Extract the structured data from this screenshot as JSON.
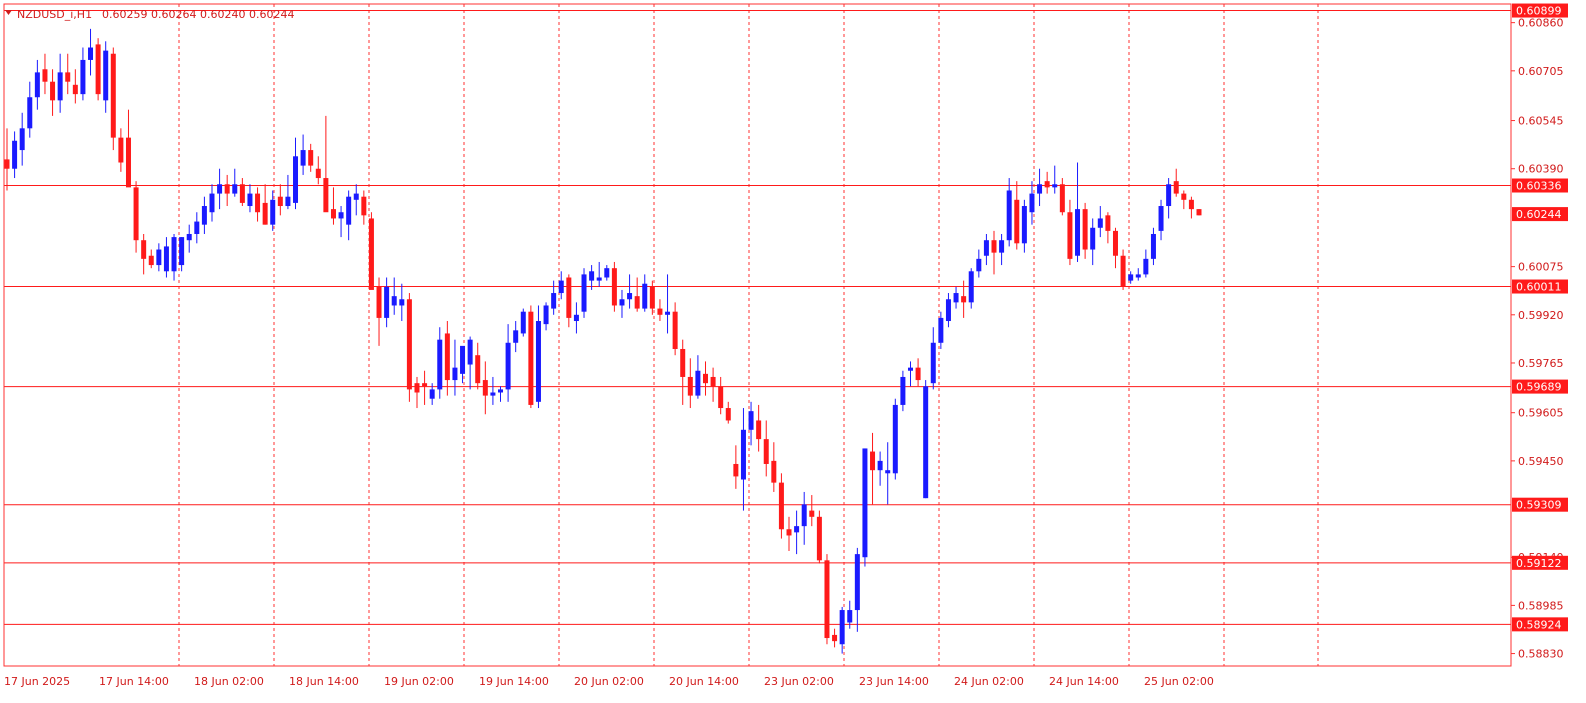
{
  "header": {
    "symbol": "NZDUSD_i,H1",
    "ohlc": "0.60259 0.60264 0.60240 0.60244"
  },
  "colors": {
    "bull": "#1a1aff",
    "bear": "#ff1a1a",
    "axis": "#ff3030",
    "grid": "#ff3030",
    "label_bg": "#ff1a1a"
  },
  "chart_data": {
    "type": "candlestick",
    "ylim": [
      0.5879,
      0.6092
    ],
    "price_axis_ticks": [
      "0.60860",
      "0.60705",
      "0.60545",
      "0.60390",
      "0.60075",
      "0.59920",
      "0.59765",
      "0.59605",
      "0.59450",
      "0.59140",
      "0.58985",
      "0.58830"
    ],
    "time_axis_labels": [
      "17 Jun 2025",
      "17 Jun 14:00",
      "18 Jun 02:00",
      "18 Jun 14:00",
      "19 Jun 02:00",
      "19 Jun 14:00",
      "20 Jun 02:00",
      "20 Jun 14:00",
      "23 Jun 02:00",
      "23 Jun 14:00",
      "24 Jun 02:00",
      "24 Jun 14:00",
      "25 Jun 02:00"
    ],
    "horizontal_levels": [
      "0.60899",
      "0.60336",
      "0.60011",
      "0.59689",
      "0.59309",
      "0.59122",
      "0.58924"
    ],
    "current_price": "0.60244",
    "candles": [
      {
        "o": 0.6042,
        "h": 0.6052,
        "l": 0.6032,
        "c": 0.6039
      },
      {
        "o": 0.6039,
        "h": 0.6051,
        "l": 0.6036,
        "c": 0.6048
      },
      {
        "o": 0.6045,
        "h": 0.6057,
        "l": 0.604,
        "c": 0.6052
      },
      {
        "o": 0.6052,
        "h": 0.6067,
        "l": 0.6049,
        "c": 0.6062
      },
      {
        "o": 0.6062,
        "h": 0.6074,
        "l": 0.6058,
        "c": 0.607
      },
      {
        "o": 0.6071,
        "h": 0.6076,
        "l": 0.6063,
        "c": 0.6067
      },
      {
        "o": 0.6067,
        "h": 0.6071,
        "l": 0.6056,
        "c": 0.6061
      },
      {
        "o": 0.6061,
        "h": 0.6076,
        "l": 0.6057,
        "c": 0.607
      },
      {
        "o": 0.607,
        "h": 0.6076,
        "l": 0.6063,
        "c": 0.6067
      },
      {
        "o": 0.6066,
        "h": 0.6071,
        "l": 0.606,
        "c": 0.6063
      },
      {
        "o": 0.6063,
        "h": 0.6078,
        "l": 0.6061,
        "c": 0.6074
      },
      {
        "o": 0.6074,
        "h": 0.6084,
        "l": 0.6069,
        "c": 0.6078
      },
      {
        "o": 0.6079,
        "h": 0.6081,
        "l": 0.6061,
        "c": 0.6063
      },
      {
        "o": 0.6061,
        "h": 0.608,
        "l": 0.6057,
        "c": 0.6077
      },
      {
        "o": 0.6076,
        "h": 0.6078,
        "l": 0.6045,
        "c": 0.6049
      },
      {
        "o": 0.6049,
        "h": 0.6052,
        "l": 0.6038,
        "c": 0.6041
      },
      {
        "o": 0.6049,
        "h": 0.6058,
        "l": 0.6038,
        "c": 0.6033
      },
      {
        "o": 0.6033,
        "h": 0.6035,
        "l": 0.6012,
        "c": 0.6016
      },
      {
        "o": 0.6016,
        "h": 0.6018,
        "l": 0.6005,
        "c": 0.601
      },
      {
        "o": 0.6011,
        "h": 0.6013,
        "l": 0.6007,
        "c": 0.6008
      },
      {
        "o": 0.6008,
        "h": 0.6015,
        "l": 0.6006,
        "c": 0.6013
      },
      {
        "o": 0.6006,
        "h": 0.6017,
        "l": 0.6004,
        "c": 0.6014
      },
      {
        "o": 0.6006,
        "h": 0.6018,
        "l": 0.6003,
        "c": 0.6017
      },
      {
        "o": 0.6008,
        "h": 0.6017,
        "l": 0.6006,
        "c": 0.6017
      },
      {
        "o": 0.6016,
        "h": 0.6021,
        "l": 0.6012,
        "c": 0.6018
      },
      {
        "o": 0.6018,
        "h": 0.6025,
        "l": 0.6015,
        "c": 0.6022
      },
      {
        "o": 0.6021,
        "h": 0.603,
        "l": 0.6018,
        "c": 0.6027
      },
      {
        "o": 0.6025,
        "h": 0.6034,
        "l": 0.6022,
        "c": 0.6031
      },
      {
        "o": 0.6031,
        "h": 0.6039,
        "l": 0.6026,
        "c": 0.6034
      },
      {
        "o": 0.6034,
        "h": 0.6037,
        "l": 0.6027,
        "c": 0.6031
      },
      {
        "o": 0.6031,
        "h": 0.6039,
        "l": 0.603,
        "c": 0.6034
      },
      {
        "o": 0.6034,
        "h": 0.6036,
        "l": 0.6027,
        "c": 0.6028
      },
      {
        "o": 0.6027,
        "h": 0.6034,
        "l": 0.6025,
        "c": 0.6031
      },
      {
        "o": 0.6031,
        "h": 0.6033,
        "l": 0.6022,
        "c": 0.6025
      },
      {
        "o": 0.6028,
        "h": 0.6034,
        "l": 0.6021,
        "c": 0.6021
      },
      {
        "o": 0.6021,
        "h": 0.6032,
        "l": 0.6019,
        "c": 0.6029
      },
      {
        "o": 0.603,
        "h": 0.6034,
        "l": 0.6024,
        "c": 0.6027
      },
      {
        "o": 0.6027,
        "h": 0.6037,
        "l": 0.6026,
        "c": 0.603
      },
      {
        "o": 0.6028,
        "h": 0.6049,
        "l": 0.6026,
        "c": 0.6043
      },
      {
        "o": 0.604,
        "h": 0.605,
        "l": 0.6037,
        "c": 0.6045
      },
      {
        "o": 0.6045,
        "h": 0.6047,
        "l": 0.6038,
        "c": 0.604
      },
      {
        "o": 0.6039,
        "h": 0.6043,
        "l": 0.6034,
        "c": 0.6036
      },
      {
        "o": 0.6036,
        "h": 0.6056,
        "l": 0.6031,
        "c": 0.6025
      },
      {
        "o": 0.6026,
        "h": 0.6033,
        "l": 0.6021,
        "c": 0.6023
      },
      {
        "o": 0.6023,
        "h": 0.6027,
        "l": 0.6017,
        "c": 0.6025
      },
      {
        "o": 0.6021,
        "h": 0.6032,
        "l": 0.6016,
        "c": 0.603
      },
      {
        "o": 0.6029,
        "h": 0.6034,
        "l": 0.6024,
        "c": 0.6031
      },
      {
        "o": 0.603,
        "h": 0.6032,
        "l": 0.6021,
        "c": 0.6024
      },
      {
        "o": 0.6023,
        "h": 0.6025,
        "l": 0.6004,
        "c": 0.6
      },
      {
        "o": 0.6001,
        "h": 0.6004,
        "l": 0.5982,
        "c": 0.5991
      },
      {
        "o": 0.5991,
        "h": 0.6004,
        "l": 0.5988,
        "c": 0.6001
      },
      {
        "o": 0.5995,
        "h": 0.6004,
        "l": 0.5992,
        "c": 0.5998
      },
      {
        "o": 0.5995,
        "h": 0.6002,
        "l": 0.599,
        "c": 0.5997
      },
      {
        "o": 0.5997,
        "h": 0.5999,
        "l": 0.5964,
        "c": 0.5968
      },
      {
        "o": 0.597,
        "h": 0.5972,
        "l": 0.5962,
        "c": 0.5967
      },
      {
        "o": 0.597,
        "h": 0.5974,
        "l": 0.5963,
        "c": 0.5969
      },
      {
        "o": 0.5965,
        "h": 0.597,
        "l": 0.5963,
        "c": 0.5968
      },
      {
        "o": 0.5968,
        "h": 0.5988,
        "l": 0.5965,
        "c": 0.5984
      },
      {
        "o": 0.5986,
        "h": 0.599,
        "l": 0.5966,
        "c": 0.5971
      },
      {
        "o": 0.5971,
        "h": 0.5984,
        "l": 0.5966,
        "c": 0.5975
      },
      {
        "o": 0.5973,
        "h": 0.598,
        "l": 0.597,
        "c": 0.5982
      },
      {
        "o": 0.5976,
        "h": 0.5985,
        "l": 0.5968,
        "c": 0.5984
      },
      {
        "o": 0.5979,
        "h": 0.5983,
        "l": 0.5968,
        "c": 0.597
      },
      {
        "o": 0.5971,
        "h": 0.5977,
        "l": 0.596,
        "c": 0.5966
      },
      {
        "o": 0.5966,
        "h": 0.5972,
        "l": 0.5963,
        "c": 0.5967
      },
      {
        "o": 0.5967,
        "h": 0.5969,
        "l": 0.5964,
        "c": 0.5968
      },
      {
        "o": 0.5968,
        "h": 0.5989,
        "l": 0.5964,
        "c": 0.5983
      },
      {
        "o": 0.5983,
        "h": 0.599,
        "l": 0.598,
        "c": 0.5987
      },
      {
        "o": 0.5986,
        "h": 0.5994,
        "l": 0.5985,
        "c": 0.5993
      },
      {
        "o": 0.5993,
        "h": 0.5995,
        "l": 0.5962,
        "c": 0.5963
      },
      {
        "o": 0.5964,
        "h": 0.5995,
        "l": 0.5962,
        "c": 0.599
      },
      {
        "o": 0.5989,
        "h": 0.5996,
        "l": 0.5987,
        "c": 0.5995
      },
      {
        "o": 0.5994,
        "h": 0.6003,
        "l": 0.5992,
        "c": 0.5999
      },
      {
        "o": 0.5999,
        "h": 0.6006,
        "l": 0.5997,
        "c": 0.6003
      },
      {
        "o": 0.6004,
        "h": 0.6005,
        "l": 0.5988,
        "c": 0.5991
      },
      {
        "o": 0.599,
        "h": 0.5996,
        "l": 0.5986,
        "c": 0.5992
      },
      {
        "o": 0.5993,
        "h": 0.6007,
        "l": 0.5991,
        "c": 0.6005
      },
      {
        "o": 0.6003,
        "h": 0.6008,
        "l": 0.6,
        "c": 0.6006
      },
      {
        "o": 0.6003,
        "h": 0.6009,
        "l": 0.6001,
        "c": 0.6004
      },
      {
        "o": 0.6004,
        "h": 0.6008,
        "l": 0.6003,
        "c": 0.6007
      },
      {
        "o": 0.6007,
        "h": 0.6009,
        "l": 0.5993,
        "c": 0.5995
      },
      {
        "o": 0.5995,
        "h": 0.6,
        "l": 0.5991,
        "c": 0.5997
      },
      {
        "o": 0.5997,
        "h": 0.6005,
        "l": 0.5994,
        "c": 0.5999
      },
      {
        "o": 0.5998,
        "h": 0.6004,
        "l": 0.5993,
        "c": 0.5994
      },
      {
        "o": 0.5994,
        "h": 0.6005,
        "l": 0.5993,
        "c": 0.6002
      },
      {
        "o": 0.6001,
        "h": 0.6003,
        "l": 0.5992,
        "c": 0.5994
      },
      {
        "o": 0.5994,
        "h": 0.5997,
        "l": 0.599,
        "c": 0.5992
      },
      {
        "o": 0.5992,
        "h": 0.6005,
        "l": 0.5986,
        "c": 0.5993
      },
      {
        "o": 0.5993,
        "h": 0.5996,
        "l": 0.5979,
        "c": 0.5981
      },
      {
        "o": 0.5981,
        "h": 0.5984,
        "l": 0.5963,
        "c": 0.5972
      },
      {
        "o": 0.5972,
        "h": 0.5978,
        "l": 0.5962,
        "c": 0.5966
      },
      {
        "o": 0.5966,
        "h": 0.5979,
        "l": 0.5965,
        "c": 0.5974
      },
      {
        "o": 0.5973,
        "h": 0.5977,
        "l": 0.5966,
        "c": 0.597
      },
      {
        "o": 0.5972,
        "h": 0.5975,
        "l": 0.5964,
        "c": 0.5969
      },
      {
        "o": 0.5969,
        "h": 0.5972,
        "l": 0.596,
        "c": 0.5962
      },
      {
        "o": 0.5962,
        "h": 0.5964,
        "l": 0.5957,
        "c": 0.5958
      },
      {
        "o": 0.5944,
        "h": 0.595,
        "l": 0.5936,
        "c": 0.594
      },
      {
        "o": 0.5939,
        "h": 0.5962,
        "l": 0.5929,
        "c": 0.5955
      },
      {
        "o": 0.5955,
        "h": 0.5964,
        "l": 0.595,
        "c": 0.5961
      },
      {
        "o": 0.5958,
        "h": 0.5963,
        "l": 0.5948,
        "c": 0.5952
      },
      {
        "o": 0.5952,
        "h": 0.5958,
        "l": 0.594,
        "c": 0.5944
      },
      {
        "o": 0.5945,
        "h": 0.5951,
        "l": 0.5935,
        "c": 0.5938
      },
      {
        "o": 0.5938,
        "h": 0.5941,
        "l": 0.592,
        "c": 0.5923
      },
      {
        "o": 0.5923,
        "h": 0.5927,
        "l": 0.5916,
        "c": 0.5921
      },
      {
        "o": 0.5922,
        "h": 0.5929,
        "l": 0.5915,
        "c": 0.5924
      },
      {
        "o": 0.5924,
        "h": 0.5935,
        "l": 0.5918,
        "c": 0.5931
      },
      {
        "o": 0.5929,
        "h": 0.5934,
        "l": 0.5924,
        "c": 0.5927
      },
      {
        "o": 0.5927,
        "h": 0.5929,
        "l": 0.5912,
        "c": 0.5913
      },
      {
        "o": 0.5913,
        "h": 0.5915,
        "l": 0.5886,
        "c": 0.5888
      },
      {
        "o": 0.5889,
        "h": 0.5891,
        "l": 0.5885,
        "c": 0.5887
      },
      {
        "o": 0.5886,
        "h": 0.5898,
        "l": 0.5883,
        "c": 0.5897
      },
      {
        "o": 0.5893,
        "h": 0.59,
        "l": 0.5891,
        "c": 0.5897
      },
      {
        "o": 0.5897,
        "h": 0.5917,
        "l": 0.589,
        "c": 0.5915
      },
      {
        "o": 0.5914,
        "h": 0.5949,
        "l": 0.5911,
        "c": 0.5949
      },
      {
        "o": 0.5948,
        "h": 0.5954,
        "l": 0.5931,
        "c": 0.5942
      },
      {
        "o": 0.5942,
        "h": 0.5948,
        "l": 0.5937,
        "c": 0.5945
      },
      {
        "o": 0.5941,
        "h": 0.5951,
        "l": 0.5931,
        "c": 0.5942
      },
      {
        "o": 0.5941,
        "h": 0.5965,
        "l": 0.5939,
        "c": 0.5963
      },
      {
        "o": 0.5963,
        "h": 0.5974,
        "l": 0.5961,
        "c": 0.5972
      },
      {
        "o": 0.5974,
        "h": 0.5977,
        "l": 0.5969,
        "c": 0.5975
      },
      {
        "o": 0.5975,
        "h": 0.5978,
        "l": 0.5969,
        "c": 0.5971
      },
      {
        "o": 0.5933,
        "h": 0.5971,
        "l": 0.5933,
        "c": 0.5969
      },
      {
        "o": 0.597,
        "h": 0.5988,
        "l": 0.5968,
        "c": 0.5983
      },
      {
        "o": 0.5983,
        "h": 0.5993,
        "l": 0.5981,
        "c": 0.5991
      },
      {
        "o": 0.599,
        "h": 0.5999,
        "l": 0.5988,
        "c": 0.5997
      },
      {
        "o": 0.5996,
        "h": 0.6001,
        "l": 0.5994,
        "c": 0.5999
      },
      {
        "o": 0.5998,
        "h": 0.6003,
        "l": 0.5991,
        "c": 0.5996
      },
      {
        "o": 0.5996,
        "h": 0.6007,
        "l": 0.5994,
        "c": 0.6006
      },
      {
        "o": 0.6006,
        "h": 0.6013,
        "l": 0.6004,
        "c": 0.601
      },
      {
        "o": 0.6011,
        "h": 0.6018,
        "l": 0.6008,
        "c": 0.6016
      },
      {
        "o": 0.6016,
        "h": 0.6019,
        "l": 0.6005,
        "c": 0.6012
      },
      {
        "o": 0.6012,
        "h": 0.6018,
        "l": 0.6008,
        "c": 0.6016
      },
      {
        "o": 0.6016,
        "h": 0.6036,
        "l": 0.6014,
        "c": 0.6032
      },
      {
        "o": 0.6029,
        "h": 0.6035,
        "l": 0.6013,
        "c": 0.6015
      },
      {
        "o": 0.6015,
        "h": 0.6029,
        "l": 0.6012,
        "c": 0.6027
      },
      {
        "o": 0.6025,
        "h": 0.6035,
        "l": 0.6021,
        "c": 0.6031
      },
      {
        "o": 0.6031,
        "h": 0.6039,
        "l": 0.6027,
        "c": 0.6034
      },
      {
        "o": 0.6035,
        "h": 0.6038,
        "l": 0.6031,
        "c": 0.6033
      },
      {
        "o": 0.6033,
        "h": 0.604,
        "l": 0.6031,
        "c": 0.6034
      },
      {
        "o": 0.6034,
        "h": 0.6036,
        "l": 0.6024,
        "c": 0.6025
      },
      {
        "o": 0.6025,
        "h": 0.6029,
        "l": 0.6008,
        "c": 0.601
      },
      {
        "o": 0.6011,
        "h": 0.6041,
        "l": 0.6009,
        "c": 0.6026
      },
      {
        "o": 0.6026,
        "h": 0.6028,
        "l": 0.601,
        "c": 0.6013
      },
      {
        "o": 0.6013,
        "h": 0.6023,
        "l": 0.6008,
        "c": 0.602
      },
      {
        "o": 0.602,
        "h": 0.6027,
        "l": 0.6017,
        "c": 0.6023
      },
      {
        "o": 0.6024,
        "h": 0.6025,
        "l": 0.6015,
        "c": 0.6019
      },
      {
        "o": 0.6019,
        "h": 0.602,
        "l": 0.6007,
        "c": 0.6011
      },
      {
        "o": 0.6011,
        "h": 0.6013,
        "l": 0.6,
        "c": 0.6001
      },
      {
        "o": 0.6003,
        "h": 0.6006,
        "l": 0.6002,
        "c": 0.6005
      },
      {
        "o": 0.6004,
        "h": 0.6007,
        "l": 0.6003,
        "c": 0.6005
      },
      {
        "o": 0.6005,
        "h": 0.6013,
        "l": 0.6004,
        "c": 0.601
      },
      {
        "o": 0.601,
        "h": 0.602,
        "l": 0.6008,
        "c": 0.6018
      },
      {
        "o": 0.6019,
        "h": 0.6029,
        "l": 0.6016,
        "c": 0.6027
      },
      {
        "o": 0.6027,
        "h": 0.6036,
        "l": 0.6023,
        "c": 0.6034
      },
      {
        "o": 0.6035,
        "h": 0.6039,
        "l": 0.603,
        "c": 0.6031
      },
      {
        "o": 0.6031,
        "h": 0.6032,
        "l": 0.6026,
        "c": 0.6029
      },
      {
        "o": 0.6029,
        "h": 0.603,
        "l": 0.6023,
        "c": 0.6026
      },
      {
        "o": 0.6026,
        "h": 0.6026,
        "l": 0.6024,
        "c": 0.6024
      }
    ]
  }
}
